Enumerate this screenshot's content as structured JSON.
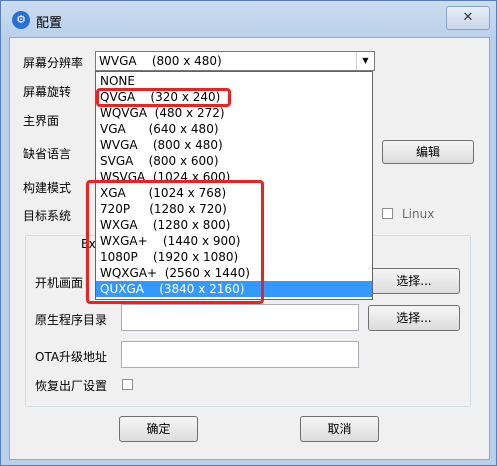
{
  "window": {
    "title": "配置",
    "close_label": "✕",
    "app_icon": "settings-icon"
  },
  "labels": {
    "resolution": "屏幕分辨率",
    "rotation": "屏幕旋转",
    "main_ui": "主界面",
    "default_language": "缺省语言",
    "build_mode": "构建模式",
    "target_system": "目标系统",
    "group_title": "Ex",
    "boot_screen": "开机画面",
    "native_dir": "原生程序目录",
    "ota_url": "OTA升级地址",
    "factory_reset": "恢复出厂设置"
  },
  "buttons": {
    "edit": "编辑",
    "choose_boot": "选择...",
    "choose_native": "选择...",
    "ok": "确定",
    "cancel": "取消"
  },
  "target_system_option": "Linux",
  "resolution_combo": {
    "selected": "WVGA    (800 x 480)",
    "options": [
      "NONE",
      "QVGA    (320 x 240)",
      "WQVGA  (480 x 272)",
      "VGA      (640 x 480)",
      "WVGA    (800 x 480)",
      "SVGA    (800 x 600)",
      "WSVGA  (1024 x 600)",
      "XGA      (1024 x 768)",
      "720P     (1280 x 720)",
      "WXGA    (1280 x 800)",
      "WXGA+    (1440 x 900)",
      "1080P    (1920 x 1080)",
      "WQXGA+  (2560 x 1440)",
      "QUXGA    (3840 x 2160)"
    ],
    "highlighted": "QUXGA    (3840 x 2160)"
  },
  "colors": {
    "highlight_border": "#ee2020",
    "selection": "#3399ff"
  }
}
